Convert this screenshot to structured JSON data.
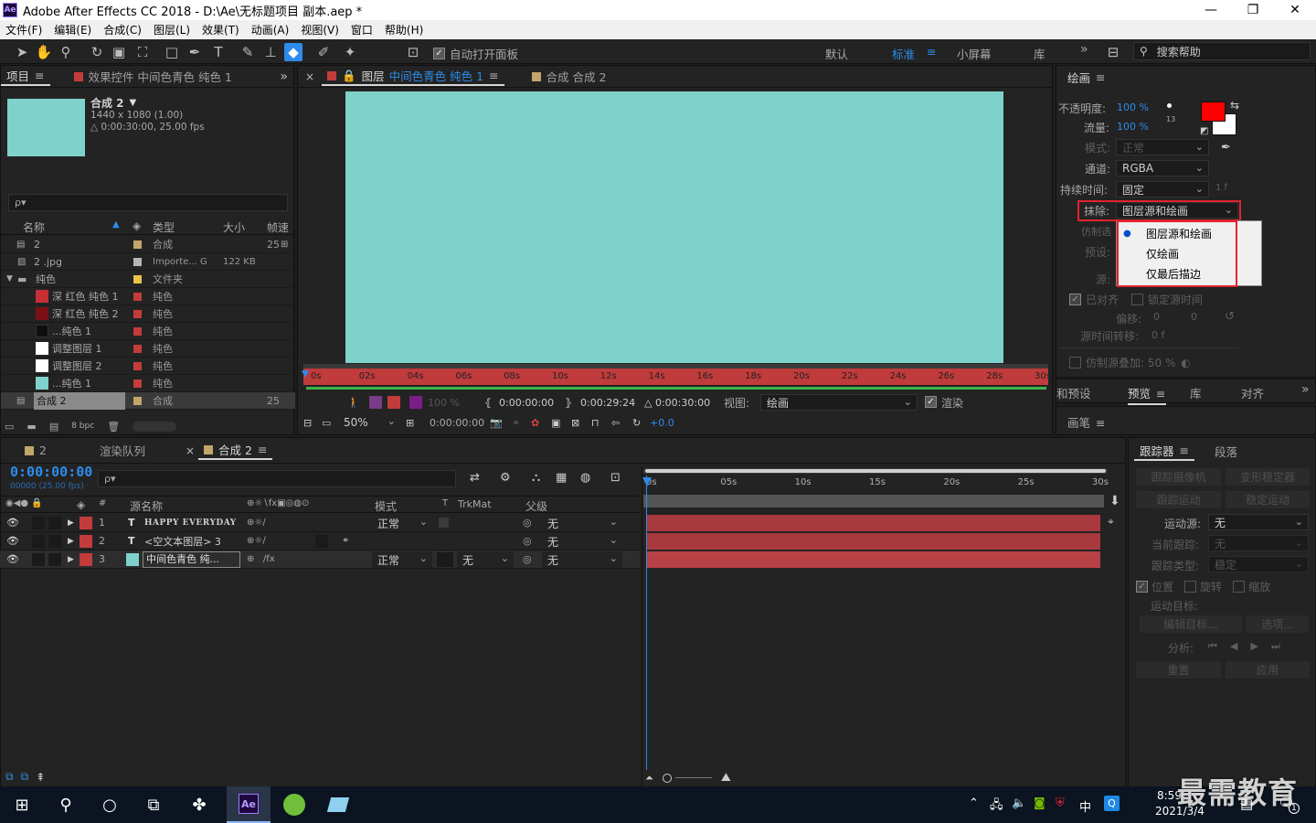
{
  "window": {
    "app_logo": "Ae",
    "title": "Adobe After Effects CC 2018 - D:\\Ae\\无标题项目 副本.aep *",
    "min": "—",
    "max": "❐",
    "close": "✕"
  },
  "menu": [
    "文件(F)",
    "编辑(E)",
    "合成(C)",
    "图层(L)",
    "效果(T)",
    "动画(A)",
    "视图(V)",
    "窗口",
    "帮助(H)"
  ],
  "toolbar": {
    "auto_open_panel": "自动打开面板",
    "workspaces": [
      "默认",
      "标准",
      "小屏幕",
      "库"
    ],
    "workspace_menu": "≡",
    "more": "»",
    "help_search": "搜索帮助"
  },
  "project": {
    "tab_project": "项目",
    "tab_effects": "效果控件 中间色青色 纯色 1",
    "more": "»",
    "selected_name": "合成 2",
    "selected_dims": "1440 x 1080 (1.00)",
    "selected_duration": "△ 0:00:30:00, 25.00 fps",
    "search_placeholder": "ρ▾",
    "col_name": "名称",
    "col_type": "类型",
    "col_size": "大小",
    "col_fps": "帧速",
    "rows": [
      {
        "name": "2",
        "type": "合成",
        "size": "",
        "fps": "25"
      },
      {
        "name": "2 .jpg",
        "type": "Importe... G",
        "size": "122 KB",
        "fps": ""
      },
      {
        "name": "纯色",
        "type": "文件夹",
        "size": "",
        "fps": ""
      },
      {
        "name": "深 红色 纯色 1",
        "type": "纯色",
        "size": "",
        "fps": ""
      },
      {
        "name": "深 红色 纯色 2",
        "type": "纯色",
        "size": "",
        "fps": ""
      },
      {
        "name": "...纯色 1",
        "type": "纯色",
        "size": "",
        "fps": ""
      },
      {
        "name": "调整图层 1",
        "type": "纯色",
        "size": "",
        "fps": ""
      },
      {
        "name": "调整图层 2",
        "type": "纯色",
        "size": "",
        "fps": ""
      },
      {
        "name": "...纯色 1",
        "type": "纯色",
        "size": "",
        "fps": ""
      },
      {
        "name": "合成 2",
        "type": "合成",
        "size": "",
        "fps": "25"
      }
    ],
    "bpc": "8 bpc"
  },
  "viewer": {
    "tab_layer_prefix": "图层",
    "tab_layer_name": "中间色青色 纯色 1",
    "tab_comp": "合成 合成 2",
    "ticks": [
      "0s",
      "02s",
      "04s",
      "06s",
      "08s",
      "10s",
      "12s",
      "14s",
      "16s",
      "18s",
      "20s",
      "22s",
      "24s",
      "26s",
      "28s",
      "30s"
    ],
    "opacity": "100 %",
    "in_time": "0:00:00:00",
    "out_time": "0:00:29:24",
    "duration": "△ 0:00:30:00",
    "view_label": "视图:",
    "view_value": "绘画",
    "render_label": "渲染",
    "zoom": "50%",
    "current_time": "0:00:00:00",
    "exposure": "+0.0"
  },
  "paint": {
    "title": "绘画",
    "opacity_label": "不透明度:",
    "opacity_value": "100 %",
    "flow_label": "流量:",
    "flow_value": "100 %",
    "brush_size": "13",
    "mode_label": "模式:",
    "mode_value": "正常",
    "channel_label": "通道:",
    "channel_value": "RGBA",
    "duration_label": "持续时间:",
    "duration_value": "固定",
    "duration_frames": "1 f",
    "erase_label": "抹除:",
    "erase_value": "图层源和绘画",
    "clone_label": "仿制选",
    "preset_label": "预设:",
    "source_label": "源:",
    "erase_options": [
      "图层源和绘画",
      "仅绘画",
      "仅最后描边"
    ],
    "aligned": "已对齐",
    "lock_source_time": "锁定源时间",
    "offset_label": "偏移:",
    "offset_x": "0",
    "offset_y": "0",
    "source_time_label": "源时间转移:",
    "source_time_value": "0 f",
    "clone_overlay": "仿制源叠加: 50 %",
    "fg_color": "#ff0000",
    "bg_color": "#ffffff"
  },
  "lower_right_tabs": {
    "presets": "和预设",
    "preview": "预览",
    "library": "库",
    "align": "对齐",
    "more": "»",
    "brush": "画笔"
  },
  "timeline": {
    "tab_comp2": "2",
    "tab_render": "渲染队列",
    "tab_active": "合成 2",
    "timecode": "0:00:00:00",
    "frame_info": "00000 (25.00 fps)",
    "col_source": "源名称",
    "col_mode": "模式",
    "col_t": "T",
    "col_trkmat": "TrkMat",
    "col_parent": "父级",
    "ruler_ticks": [
      "0s",
      "05s",
      "10s",
      "15s",
      "20s",
      "25s",
      "30s"
    ],
    "layers": [
      {
        "num": "1",
        "type": "T",
        "name": "HAPPY EVERYDAY",
        "mode": "正常",
        "trkmat": "",
        "parent": "无",
        "color": "#c23c3c"
      },
      {
        "num": "2",
        "type": "T",
        "name": "<空文本图层> 3",
        "mode": "",
        "trkmat": "",
        "parent": "无",
        "color": "#c23c3c"
      },
      {
        "num": "3",
        "type": "",
        "name": "中间色青色 纯...",
        "mode": "正常",
        "trkmat": "无",
        "parent": "无",
        "color": "#c23c3c"
      }
    ]
  },
  "tracker": {
    "tab_tracker": "跟踪器",
    "tab_paragraph": "段落",
    "track_camera": "跟踪摄像机",
    "warp_stabilizer": "变形稳定器",
    "track_motion": "跟踪运动",
    "stabilize_motion": "稳定运动",
    "motion_source_label": "运动源:",
    "motion_source_value": "无",
    "current_track_label": "当前跟踪:",
    "current_track_value": "无",
    "track_type_label": "跟踪类型:",
    "track_type_value": "稳定",
    "position": "位置",
    "rotation": "旋转",
    "scale": "缩放",
    "motion_target_label": "运动目标:",
    "edit_target": "编辑目标...",
    "options": "选项...",
    "analyze_label": "分析:",
    "reset": "重置",
    "apply": "应用"
  },
  "taskbar": {
    "time": "8:59",
    "date": "2021/3/4",
    "ime": "中",
    "notification_count": "1",
    "watermark": "最需教育"
  }
}
